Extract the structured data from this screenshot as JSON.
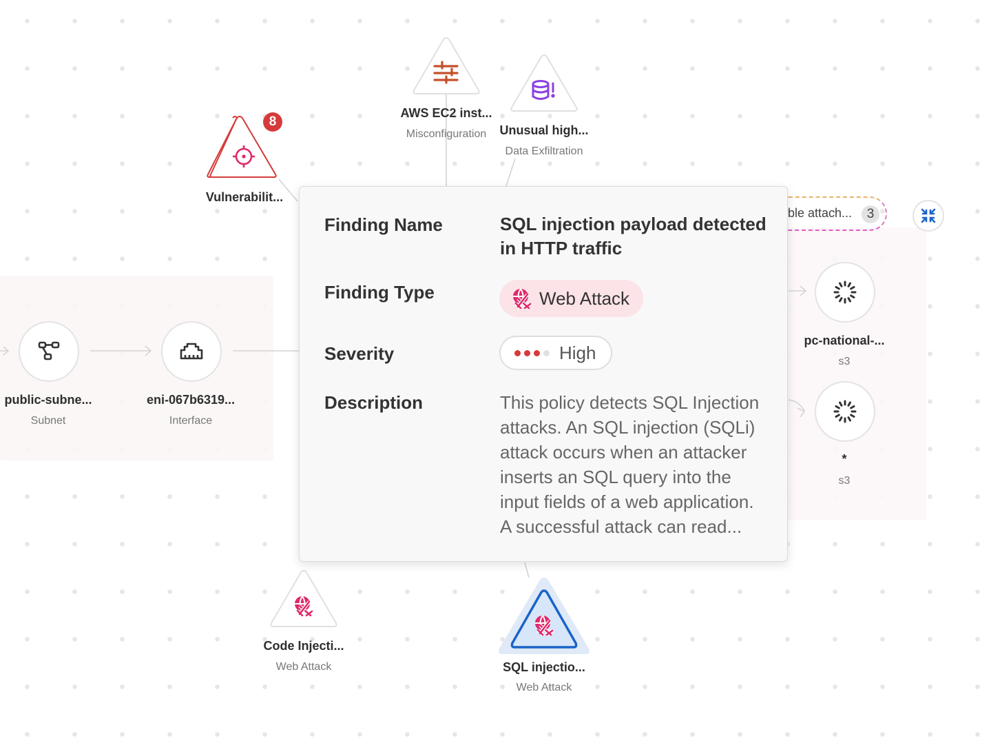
{
  "graph": {
    "nodes": {
      "aws_ec2": {
        "title": "AWS EC2 inst...",
        "subtitle": "Misconfiguration",
        "icon": "sliders-icon",
        "icon_color": "#c4502a"
      },
      "unusual_high": {
        "title": "Unusual high...",
        "subtitle": "Data Exfiltration",
        "icon": "database-alert-icon",
        "icon_color": "#8b3fe0"
      },
      "vulnerability": {
        "title": "Vulnerabilit...",
        "subtitle": "",
        "icon": "crosshair-icon",
        "icon_color": "#e0296b",
        "count_badge": "8",
        "border_color": "#d63b3b"
      },
      "public_subnet": {
        "title": "public-subne...",
        "subtitle": "Subnet",
        "icon": "network-nodes-icon"
      },
      "eni": {
        "title": "eni-067b6319...",
        "subtitle": "Interface",
        "icon": "ethernet-port-icon"
      },
      "pc_national": {
        "title": "pc-national-...",
        "subtitle": "s3",
        "icon": "loading-spinner-icon"
      },
      "s3_wildcard": {
        "title": "*",
        "subtitle": "s3",
        "icon": "loading-spinner-icon"
      },
      "code_injection": {
        "title": "Code Injecti...",
        "subtitle": "Web Attack",
        "icon": "web-attack-icon",
        "icon_color": "#e0296b"
      },
      "sql_injection": {
        "title": "SQL injectio...",
        "subtitle": "Web Attack",
        "icon": "web-attack-icon",
        "icon_color": "#e0296b",
        "selected": true,
        "selected_color": "#1a64c8"
      }
    },
    "group_chip": {
      "label": "ble attach...",
      "count": "3"
    },
    "collapse_button": {
      "icon": "collapse-arrows-icon",
      "color": "#1a64c8"
    }
  },
  "popover": {
    "finding_name_label": "Finding Name",
    "finding_name_value": "SQL injection payload detected in HTTP traffic",
    "finding_type_label": "Finding Type",
    "finding_type_value": "Web Attack",
    "finding_type_color": "#fbe3e8",
    "severity_label": "Severity",
    "severity_value": "High",
    "severity_level": 3,
    "severity_max": 4,
    "severity_color": "#d63b3b",
    "description_label": "Description",
    "description_value": "This policy detects SQL Injection attacks. An SQL injection (SQLi) attack occurs when an attacker inserts an SQL query into the input fields of a web application. A successful attack can read..."
  }
}
